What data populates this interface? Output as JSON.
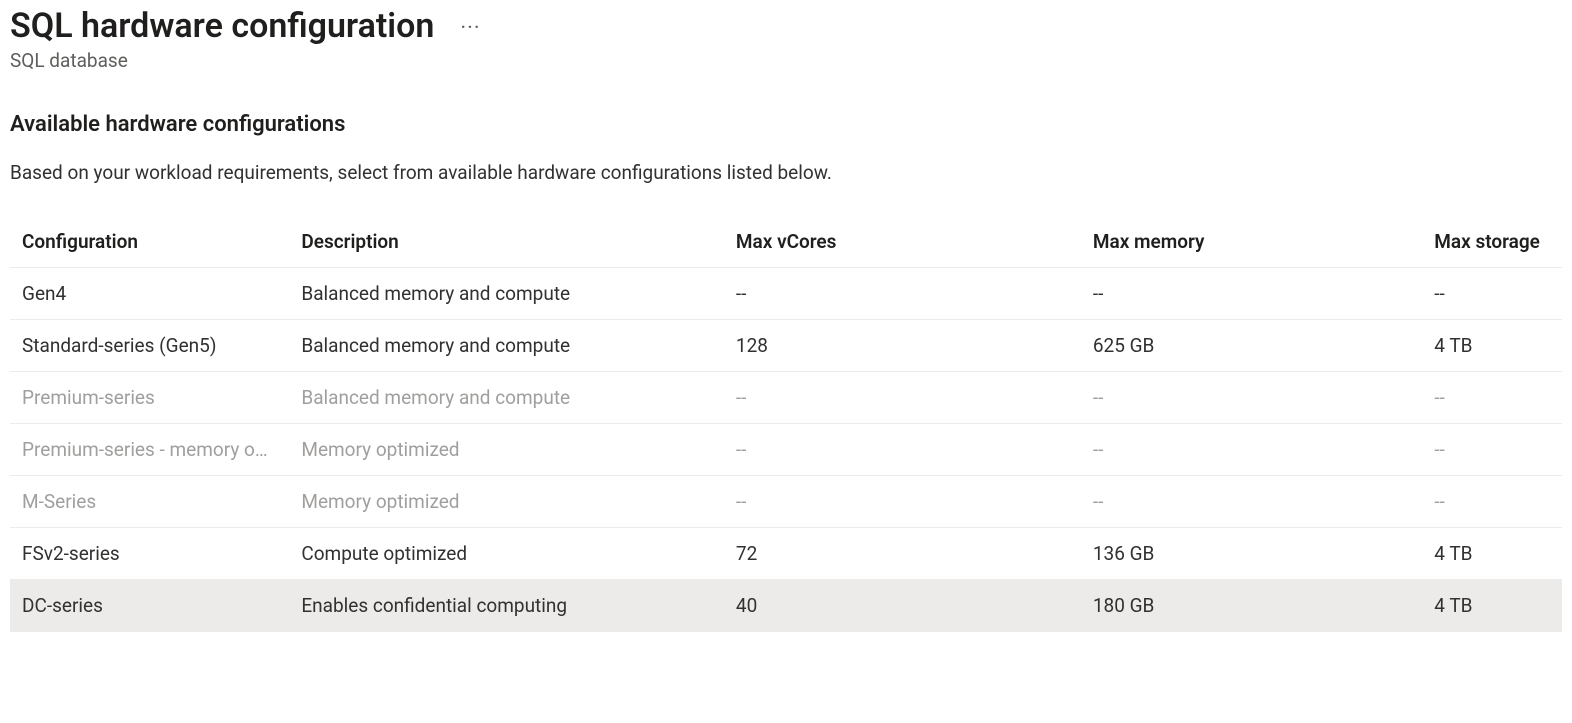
{
  "header": {
    "title": "SQL hardware configuration",
    "subtitle": "SQL database",
    "more_label": "···"
  },
  "section": {
    "heading": "Available hardware configurations",
    "description": "Based on your workload requirements, select from available hardware configurations listed below."
  },
  "table": {
    "columns": {
      "configuration": "Configuration",
      "description": "Description",
      "max_vcores": "Max vCores",
      "max_memory": "Max memory",
      "max_storage": "Max storage"
    },
    "rows": [
      {
        "configuration": "Gen4",
        "description": "Balanced memory and compute",
        "max_vcores": "--",
        "max_memory": "--",
        "max_storage": "--",
        "disabled": false,
        "selected": false
      },
      {
        "configuration": "Standard-series (Gen5)",
        "description": "Balanced memory and compute",
        "max_vcores": "128",
        "max_memory": "625 GB",
        "max_storage": "4 TB",
        "disabled": false,
        "selected": false
      },
      {
        "configuration": "Premium-series",
        "description": "Balanced memory and compute",
        "max_vcores": "--",
        "max_memory": "--",
        "max_storage": "--",
        "disabled": true,
        "selected": false
      },
      {
        "configuration": "Premium-series - memory optimized",
        "description": "Memory optimized",
        "max_vcores": "--",
        "max_memory": "--",
        "max_storage": "--",
        "disabled": true,
        "selected": false
      },
      {
        "configuration": "M-Series",
        "description": "Memory optimized",
        "max_vcores": "--",
        "max_memory": "--",
        "max_storage": "--",
        "disabled": true,
        "selected": false
      },
      {
        "configuration": "FSv2-series",
        "description": "Compute optimized",
        "max_vcores": "72",
        "max_memory": "136 GB",
        "max_storage": "4 TB",
        "disabled": false,
        "selected": false
      },
      {
        "configuration": "DC-series",
        "description": "Enables confidential computing",
        "max_vcores": "40",
        "max_memory": "180 GB",
        "max_storage": "4 TB",
        "disabled": false,
        "selected": true
      }
    ]
  }
}
